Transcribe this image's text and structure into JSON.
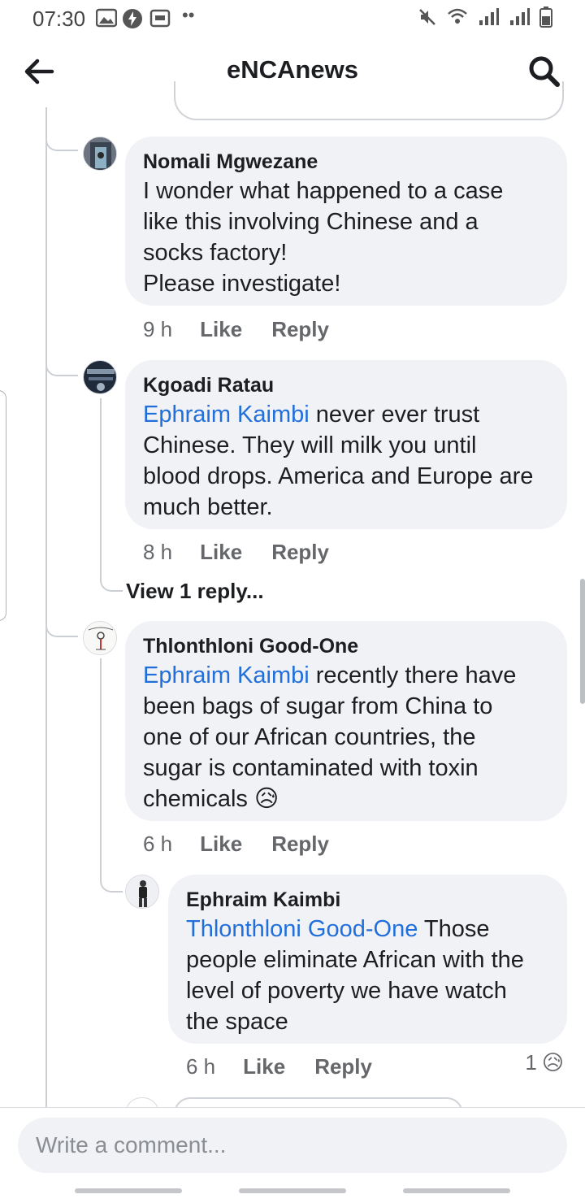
{
  "status_bar": {
    "time": "07:30",
    "dots": "••"
  },
  "header": {
    "title": "eNCAnews"
  },
  "comments": [
    {
      "author": "Nomali Mgwezane",
      "text_lines": [
        "I wonder what happened to a case",
        "like this involving Chinese and a",
        "socks factory!",
        "Please investigate!"
      ],
      "time": "9 h",
      "like": "Like",
      "reply": "Reply"
    },
    {
      "author": "Kgoadi Ratau",
      "mention": "Ephraim Kaimbi",
      "text_first": " never ever trust",
      "text_lines": [
        "Chinese. They will milk you until",
        "blood drops. America and Europe are",
        "much better."
      ],
      "time": "8 h",
      "like": "Like",
      "reply": "Reply",
      "view_replies": "View 1 reply..."
    },
    {
      "author": "Thlonthloni Good-One",
      "mention": "Ephraim Kaimbi",
      "text_first": " recently there have",
      "text_lines": [
        "been bags of sugar from China to",
        "one of our African countries, the",
        "sugar is contaminated with toxin"
      ],
      "text_last": "chemicals",
      "emoji": "😥",
      "time": "6 h",
      "like": "Like",
      "reply": "Reply"
    },
    {
      "author": "Ephraim Kaimbi",
      "mention": "Thlonthloni Good-One",
      "text_first": " Those",
      "text_lines": [
        "people eliminate African with the",
        "level of poverty we have watch",
        "the space"
      ],
      "time": "6 h",
      "like": "Like",
      "reply": "Reply",
      "reaction_count": "1",
      "reaction_emoji": "😥"
    }
  ],
  "composer": {
    "placeholder": "Write a comment..."
  }
}
